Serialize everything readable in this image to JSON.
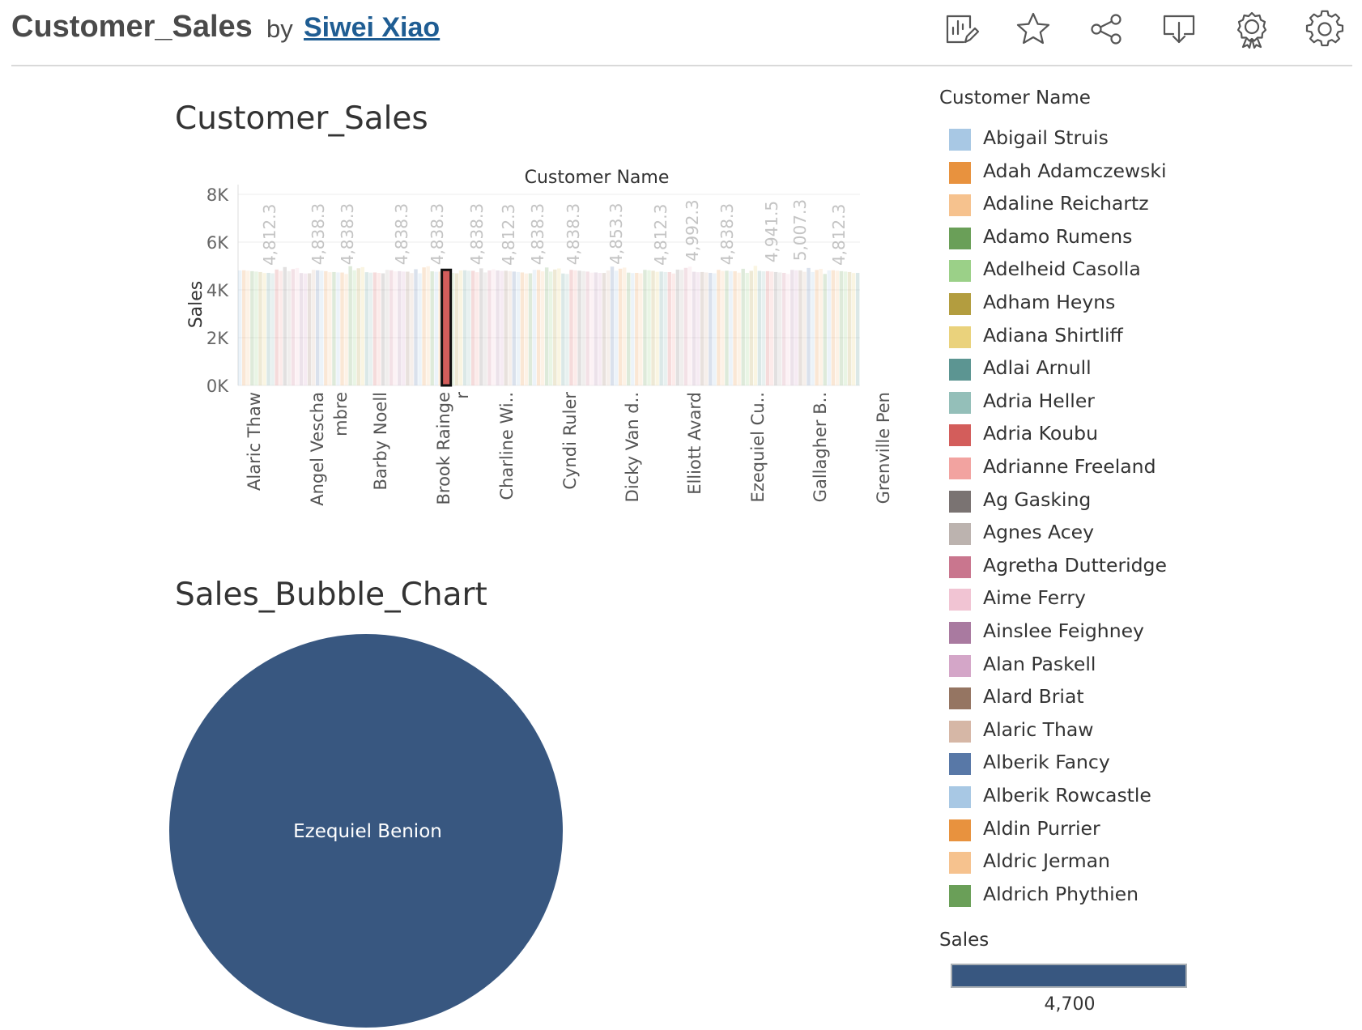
{
  "header": {
    "workbook_title": "Customer_Sales",
    "by_text": "by",
    "author": "Siwei Xiao",
    "toolbar": [
      {
        "name": "view-data",
        "icon": "chart-edit-icon"
      },
      {
        "name": "favorite",
        "icon": "star-icon"
      },
      {
        "name": "share",
        "icon": "share-icon"
      },
      {
        "name": "download",
        "icon": "download-icon"
      },
      {
        "name": "metrics",
        "icon": "badge-icon"
      },
      {
        "name": "settings",
        "icon": "gear-icon"
      }
    ]
  },
  "bar_sheet": {
    "title": "Customer_Sales"
  },
  "bubble_sheet": {
    "title": "Sales_Bubble_Chart"
  },
  "legend": {
    "title": "Customer Name",
    "items": [
      {
        "label": "Abigail Struis",
        "color": "#a8c8e4"
      },
      {
        "label": "Adah Adamczewski",
        "color": "#e8923e"
      },
      {
        "label": "Adaline Reichartz",
        "color": "#f6c28e"
      },
      {
        "label": "Adamo Rumens",
        "color": "#6a9f58"
      },
      {
        "label": "Adelheid Casolla",
        "color": "#9bd088"
      },
      {
        "label": "Adham Heyns",
        "color": "#b39d3f"
      },
      {
        "label": "Adiana Shirtliff",
        "color": "#ead27c"
      },
      {
        "label": "Adlai Arnull",
        "color": "#5c9592"
      },
      {
        "label": "Adria Heller",
        "color": "#94bfb9"
      },
      {
        "label": "Adria Koubu",
        "color": "#d35d5b"
      },
      {
        "label": "Adrianne Freeland",
        "color": "#f2a3a0"
      },
      {
        "label": "Ag Gasking",
        "color": "#7a7372"
      },
      {
        "label": "Agnes Acey",
        "color": "#bcb3af"
      },
      {
        "label": "Agretha Dutteridge",
        "color": "#c9768e"
      },
      {
        "label": "Aime Ferry",
        "color": "#f1c4d3"
      },
      {
        "label": "Ainslee Feighney",
        "color": "#a97aa0"
      },
      {
        "label": "Alan Paskell",
        "color": "#d4a6c8"
      },
      {
        "label": "Alard Briat",
        "color": "#957562"
      },
      {
        "label": "Alaric Thaw",
        "color": "#d6b7a6"
      },
      {
        "label": "Alberik Fancy",
        "color": "#5878a7"
      },
      {
        "label": "Alberik Rowcastle",
        "color": "#a8c8e4"
      },
      {
        "label": "Aldin Purrier",
        "color": "#e8923e"
      },
      {
        "label": "Aldric Jerman",
        "color": "#f6c28e"
      },
      {
        "label": "Aldrich Phythien",
        "color": "#6a9f58"
      }
    ]
  },
  "sales_legend": {
    "title": "Sales",
    "value": "4,700",
    "color": "#385780"
  },
  "chart_data": [
    {
      "type": "bar",
      "title": "Customer_Sales",
      "xlabel": "Customer Name",
      "ylabel": "Sales",
      "ylim": [
        0,
        8000
      ],
      "y_ticks": [
        "0K",
        "2K",
        "4K",
        "6K",
        "8K"
      ],
      "y_tick_values": [
        0,
        2000,
        4000,
        6000,
        8000
      ],
      "x_tick_labels": [
        "Alaric Thaw",
        "Angel Vescha",
        "mbre",
        "Barby Noell",
        "Brook Rainge",
        "r",
        "Charline Wi..",
        "Cyndi Ruler",
        "Dicky Van d..",
        "Elliott Avard",
        "Ezequiel Cu..",
        "Gallagher B..",
        "Grenville Pen"
      ],
      "data_labels": [
        "4,812.3",
        "4,838.3",
        "4,838.3",
        "4,838.3",
        "4,838.3",
        "4,838.3",
        "4,812.3",
        "4,838.3",
        "4,838.3",
        "4,853.3",
        "4,812.3",
        "4,992.3",
        "4,838.3",
        "4,941.5",
        "5,007.3",
        "4,812.3"
      ],
      "data_label_values": [
        4812.3,
        4838.3,
        4838.3,
        4838.3,
        4838.3,
        4838.3,
        4812.3,
        4838.3,
        4838.3,
        4853.3,
        4812.3,
        4992.3,
        4838.3,
        4941.5,
        5007.3,
        4812.3
      ],
      "highlighted_value": 4838.3,
      "highlight_color": "#d35d5b",
      "grid": true
    },
    {
      "type": "bubble",
      "title": "Sales_Bubble_Chart",
      "labels": [
        "Ezequiel Benion"
      ],
      "values": [
        4700
      ],
      "color": "#385780"
    }
  ]
}
